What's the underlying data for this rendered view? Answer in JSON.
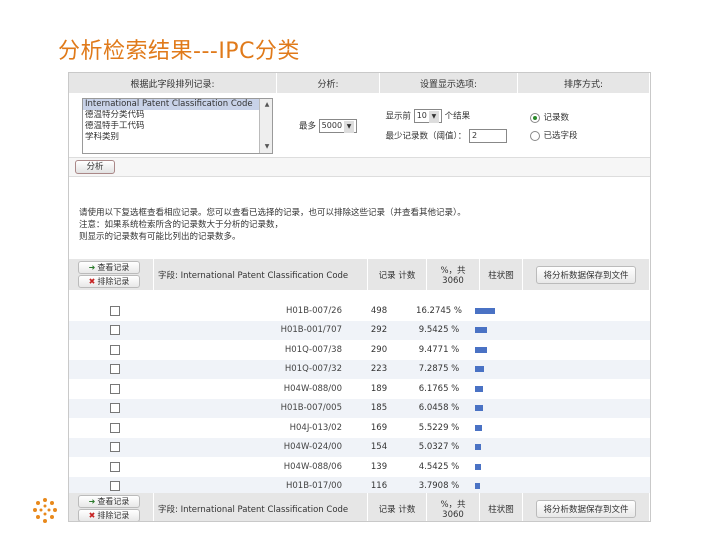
{
  "slide": {
    "title": "分析检索结果---IPC分类"
  },
  "options": {
    "col_rank_by": "根据此字段排列记录:",
    "col_analyze": "分析:",
    "col_display": "设置显示选项:",
    "col_sort": "排序方式:",
    "field_list": [
      "International Patent Classification Code",
      "德温特分类代码",
      "德温特手工代码",
      "学科类别"
    ],
    "analyze_label": "最多",
    "analyze_value": "5000",
    "show_prefix": "显示前",
    "show_value": "10",
    "show_suffix": "个结果",
    "min_records_label": "最少记录数（阈值）：",
    "min_records_value": "2",
    "sort_option1": "记录数",
    "sort_option2": "已选字段"
  },
  "analyze_button": "分析",
  "notes": [
    "请使用以下复选框查看相应记录。您可以查看已选择的记录，也可以排除这些记录（并查看其他记录）。",
    "注意：如果系统检索所含的记录数大于分析的记录数，",
    "则显示的记录数有可能比列出的记录数多。"
  ],
  "results_header": {
    "view_button": "查看记录",
    "exclude_button": "排除记录",
    "field_label": "字段: International Patent Classification Code",
    "count_label": "记录 计数",
    "pct_label_line1": "%，共",
    "pct_label_line2": "3060",
    "bar_label": "柱状图",
    "save_button": "将分析数据保存到文件"
  },
  "chart_data": {
    "type": "table",
    "columns": [
      "IPC",
      "记录计数",
      "% of 3060"
    ],
    "rows": [
      {
        "ipc": "H01B-007/26",
        "count": "498",
        "pct": "16.2745 %",
        "bar_frac": 0.163
      },
      {
        "ipc": "H01B-001/707",
        "count": "292",
        "pct": "9.5425 %",
        "bar_frac": 0.095
      },
      {
        "ipc": "H01Q-007/38",
        "count": "290",
        "pct": "9.4771 %",
        "bar_frac": 0.095
      },
      {
        "ipc": "H01Q-007/32",
        "count": "223",
        "pct": "7.2875 %",
        "bar_frac": 0.073
      },
      {
        "ipc": "H04W-088/00",
        "count": "189",
        "pct": "6.1765 %",
        "bar_frac": 0.062
      },
      {
        "ipc": "H01B-007/005",
        "count": "185",
        "pct": "6.0458 %",
        "bar_frac": 0.06
      },
      {
        "ipc": "H04J-013/02",
        "count": "169",
        "pct": "5.5229 %",
        "bar_frac": 0.055
      },
      {
        "ipc": "H04W-024/00",
        "count": "154",
        "pct": "5.0327 %",
        "bar_frac": 0.05
      },
      {
        "ipc": "H04W-088/06",
        "count": "139",
        "pct": "4.5425 %",
        "bar_frac": 0.045
      },
      {
        "ipc": "H01B-017/00",
        "count": "116",
        "pct": "3.7908 %",
        "bar_frac": 0.038
      }
    ]
  },
  "colors": {
    "title": "#e07a1a",
    "bar": "#4a72c4"
  }
}
